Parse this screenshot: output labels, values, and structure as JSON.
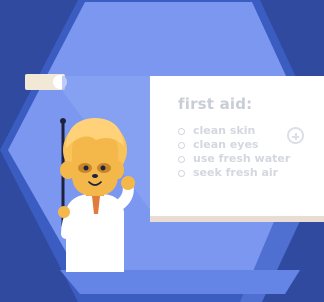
{
  "board": {
    "title": "first aid:",
    "items": [
      {
        "text": "clean skin"
      },
      {
        "text": "clean eyes"
      },
      {
        "text": "use fresh water"
      },
      {
        "text": "seek fresh air"
      }
    ]
  },
  "icons": {
    "add": "plus-circle-icon",
    "pointer": "pointer-stick-icon"
  },
  "colors": {
    "background": "#2f4a9e",
    "hexagon_light": "#7b97f0",
    "hexagon_frame": "#3d5fbf",
    "board": "#ffffff",
    "text": "#c9cdd6",
    "character_skin": "#f4b84a",
    "character_coat": "#ffffff"
  }
}
